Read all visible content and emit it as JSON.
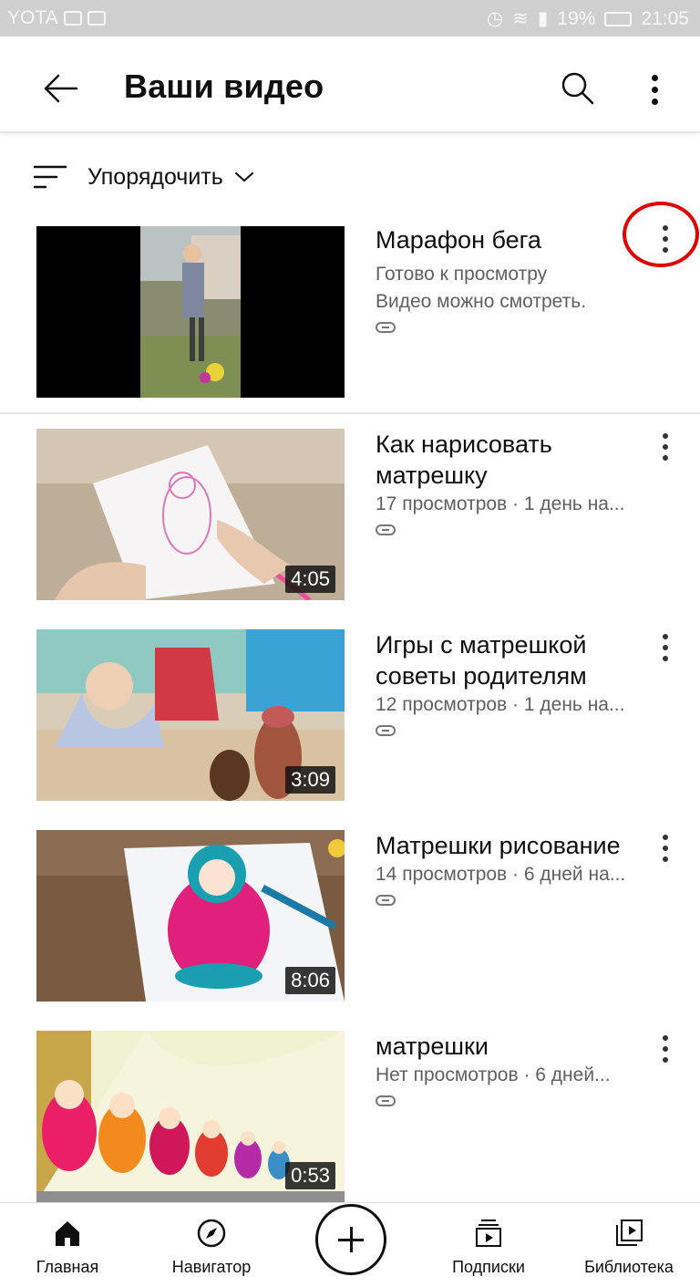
{
  "status_bar": {
    "carrier": "YOTA",
    "battery": "19%",
    "time": "21:05"
  },
  "header": {
    "title": "Ваши видео"
  },
  "sort": {
    "label": "Упорядочить"
  },
  "videos": [
    {
      "title": "Марафон бега",
      "meta_1": "Готово к просмотру",
      "meta_2": "Видео можно смотреть.",
      "duration": ""
    },
    {
      "title": "Как нарисовать матрешку",
      "meta_1": "17 просмотров · 1 день на...",
      "meta_2": "",
      "duration": "4:05"
    },
    {
      "title": "Игры с матрешкой советы родителям",
      "meta_1": "12 просмотров · 1 день на...",
      "meta_2": "",
      "duration": "3:09"
    },
    {
      "title": "Матрешки рисование",
      "meta_1": "14 просмотров · 6 дней на...",
      "meta_2": "",
      "duration": "8:06"
    },
    {
      "title": "матрешки",
      "meta_1": "Нет просмотров · 6 дней...",
      "meta_2": "",
      "duration": "0:53"
    }
  ],
  "bottom_nav": {
    "home": "Главная",
    "explore": "Навигатор",
    "subscriptions": "Подписки",
    "library": "Библиотека"
  },
  "icons": {
    "back": "arrow-left-icon",
    "search": "search-icon",
    "more": "more-vert-icon",
    "sort": "sort-icon",
    "link": "link-icon",
    "home": "home-icon",
    "explore": "compass-icon",
    "create": "plus-icon",
    "subscriptions": "subscriptions-icon",
    "library": "library-icon"
  },
  "colors": {
    "highlight": "#e00000",
    "meta_text": "#606060"
  }
}
